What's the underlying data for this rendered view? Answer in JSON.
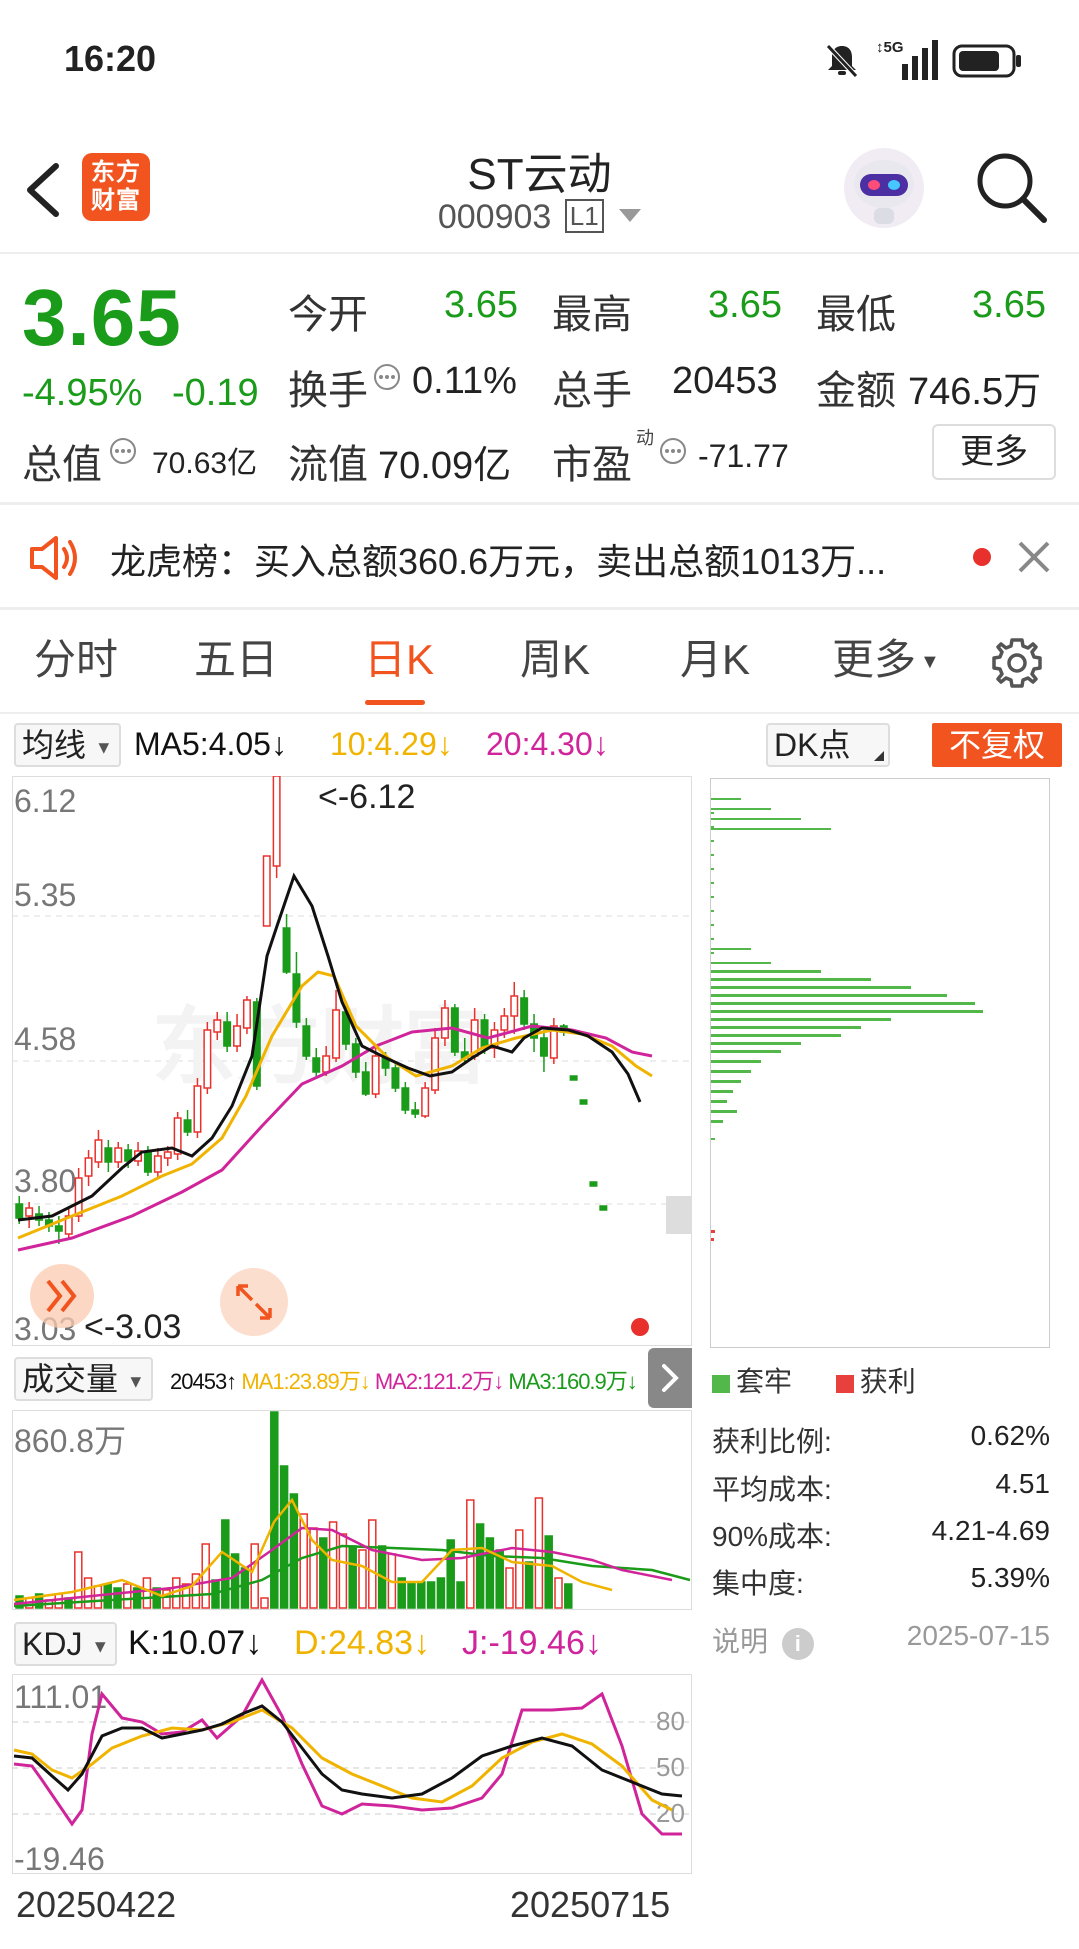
{
  "status_bar": {
    "time": "16:20",
    "network": "5G"
  },
  "header": {
    "title": "ST云动",
    "code": "000903",
    "level_badge": "L1",
    "logo_text_line1": "东方",
    "logo_text_line2": "财富"
  },
  "quote": {
    "price": "3.65",
    "change_pct": "-4.95%",
    "change": "-0.19",
    "open_label": "今开",
    "open": "3.65",
    "high_label": "最高",
    "high": "3.65",
    "low_label": "最低",
    "low": "3.65",
    "turnover_label": "换手",
    "turnover": "0.11%",
    "volume_label": "总手",
    "volume": "20453",
    "amount_label": "金额",
    "amount": "746.5万",
    "mcap_label": "总值",
    "mcap": "70.63亿",
    "float_label": "流值",
    "float": "70.09亿",
    "pe_label": "市盈",
    "pe_sup": "动",
    "pe": "-71.77",
    "more_label": "更多"
  },
  "banner": {
    "text": "龙虎榜：买入总额360.6万元，卖出总额1013万..."
  },
  "tabs": [
    "分时",
    "五日",
    "日K",
    "周K",
    "月K",
    "更多"
  ],
  "active_tab": "日K",
  "kline": {
    "ma_selector": "均线",
    "ma5": "MA5:4.05↓",
    "ma10": "10:4.29↓",
    "ma20": "20:4.30↓",
    "dk_label": "DK点",
    "fuquan_label": "不复权",
    "y_ticks": [
      "6.12",
      "5.35",
      "4.58",
      "3.80",
      "3.03"
    ],
    "max_marker": "<-6.12",
    "min_marker": "<-3.03",
    "watermark": "东方财富"
  },
  "volume": {
    "selector": "成交量",
    "value": "20453↑",
    "ma1": "MA1:23.89万↓",
    "ma2": "MA2:121.2万↓",
    "ma3": "MA3:160.9万↓",
    "y_max": "860.8万"
  },
  "kdj": {
    "selector": "KDJ",
    "k": "K:10.07↓",
    "d": "D:24.83↓",
    "j": "J:-19.46↓",
    "y_max": "111.01",
    "y_min": "-19.46",
    "levels": [
      "80",
      "50",
      "20"
    ]
  },
  "dates": {
    "start": "20250422",
    "end": "20250715"
  },
  "chip": {
    "legend_trapped": "套牢",
    "legend_profit": "获利",
    "stats": [
      {
        "label": "获利比例:",
        "value": "0.62%"
      },
      {
        "label": "平均成本:",
        "value": "4.51"
      },
      {
        "label": "90%成本:",
        "value": "4.21-4.69"
      },
      {
        "label": "集中度:",
        "value": "5.39%"
      }
    ],
    "note_label": "说明",
    "date": "2025-07-15"
  },
  "colors": {
    "up": "#e8302c",
    "down": "#1a9b1a",
    "accent": "#f2541f",
    "ma5": "#111111",
    "ma10": "#f0b400",
    "ma20": "#d0249a"
  }
}
